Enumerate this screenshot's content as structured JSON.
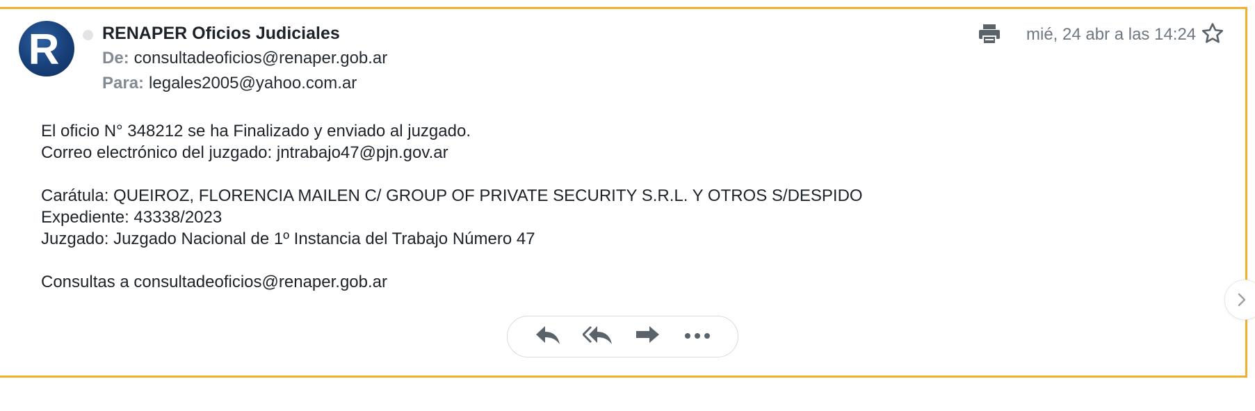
{
  "email": {
    "sender_name": "RENAPER Oficios Judiciales",
    "avatar_letter": "R",
    "from_label": "De:",
    "from_address": "consultadeoficios@renaper.gob.ar",
    "to_label": "Para:",
    "to_address": "legales2005@yahoo.com.ar",
    "date": "mié, 24 abr a las 14:24",
    "body_lines": [
      "El oficio N° 348212 se ha Finalizado y enviado al juzgado.",
      "Correo electrónico del juzgado: jntrabajo47@pjn.gov.ar",
      "",
      "Carátula: QUEIROZ, FLORENCIA MAILEN C/ GROUP OF PRIVATE SECURITY S.R.L. Y OTROS S/DESPIDO",
      "Expediente: 43338/2023",
      "Juzgado: Juzgado Nacional de 1º Instancia del Trabajo Número 47",
      "",
      "Consultas a consultadeoficios@renaper.gob.ar"
    ]
  },
  "icons": {
    "print": "print-icon",
    "star": "star-icon",
    "reply": "reply-icon",
    "reply_all": "reply-all-icon",
    "forward": "forward-icon",
    "more": "more-icon",
    "next": "chevron-right-icon"
  },
  "colors": {
    "card_border": "#f0b02e",
    "label_gray": "#828a93",
    "icon_gray": "#5b636a",
    "avatar_blue": "#173f78"
  }
}
